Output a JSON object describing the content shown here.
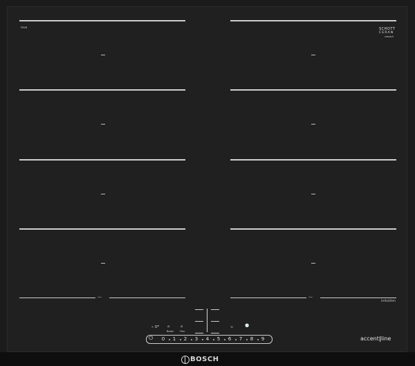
{
  "brand": {
    "schott_line1": "SCHOTT",
    "schott_line2": "CERAN",
    "schott_small": "CERAN®",
    "bottom_brand": "BOSCH",
    "accent_line_prefix": "accent",
    "accent_line_suffix": "line",
    "induction": "induction"
  },
  "model": {
    "code": "PXV6",
    "note": "· · · · ·"
  },
  "zones": {
    "left_bottom_label": "—",
    "right_bottom_label": "—"
  },
  "controls": {
    "left_group_a": "⌁ Oᴹ",
    "left_group_b": "⌂",
    "left_group_b_sub": "Boost",
    "left_group_c": "⌂",
    "left_group_c_sub": "Flex",
    "right_group_a": "≈",
    "right_group_b": "🕒",
    "power_icon": "⏻"
  },
  "slider_numbers": [
    "0",
    "1",
    "2",
    "3",
    "4",
    "5",
    "6",
    "7",
    "8",
    "9"
  ],
  "slider_marks": [
    "",
    "",
    "",
    "",
    "",
    "",
    "",
    "",
    ""
  ],
  "colors": {
    "glass": "#202020",
    "frame": "#1b1b1b",
    "lines": "#cfcfcf"
  }
}
